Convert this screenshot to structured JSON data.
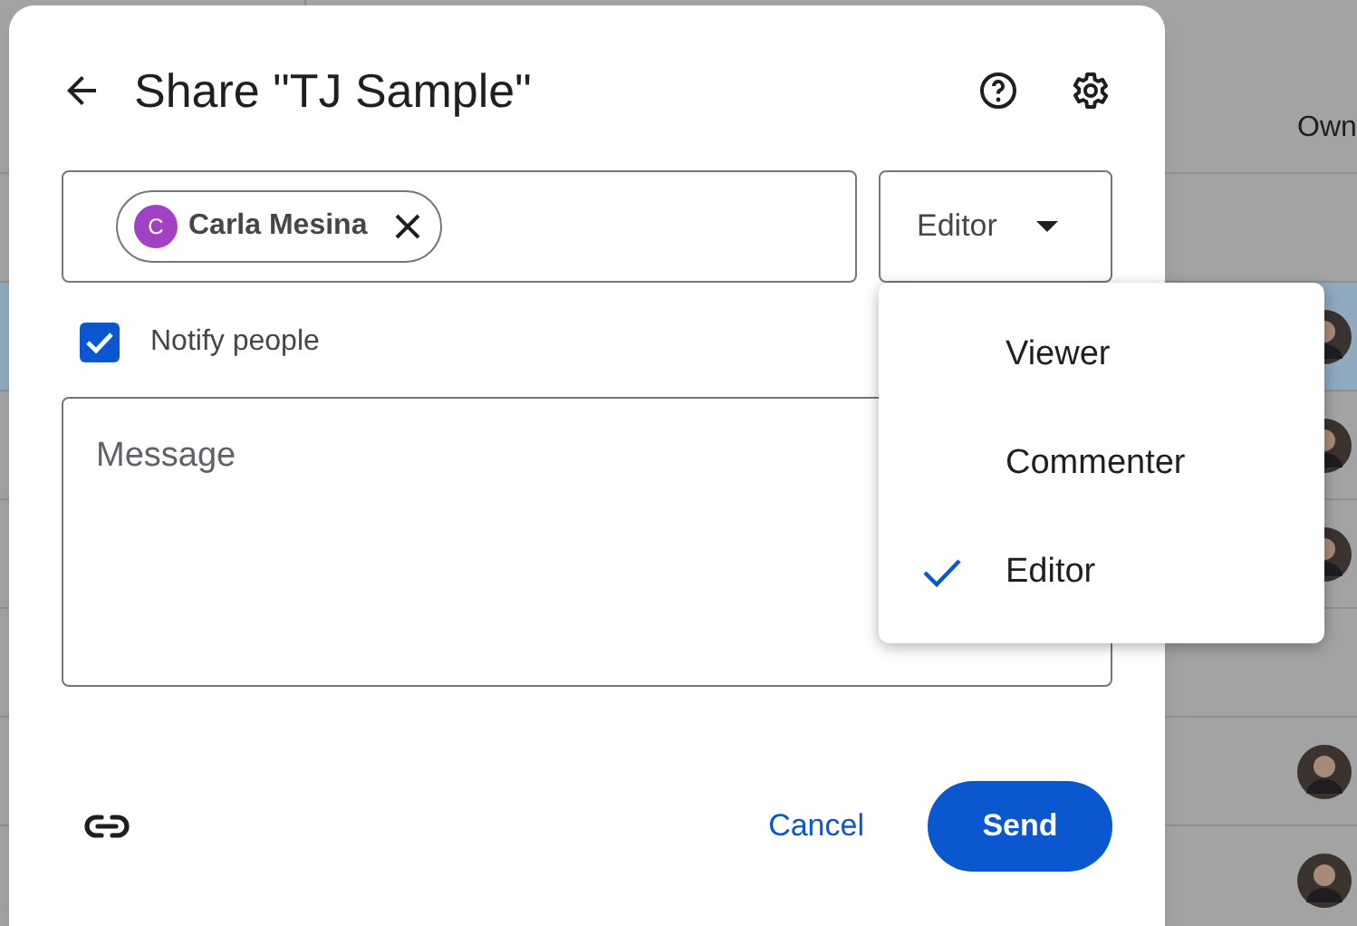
{
  "background": {
    "header_right": "Own",
    "rows": [
      {
        "selected": false,
        "avatar": false
      },
      {
        "selected": true,
        "avatar": true
      },
      {
        "selected": false,
        "avatar": true
      },
      {
        "selected": false,
        "avatar": true
      },
      {
        "selected": false,
        "avatar": false
      },
      {
        "selected": false,
        "avatar": true
      },
      {
        "selected": false,
        "avatar": true
      }
    ]
  },
  "dialog": {
    "title": "Share \"TJ Sample\"",
    "recipients": [
      {
        "initial": "C",
        "name": "Carla Mesina",
        "color": "#a142c4"
      }
    ],
    "role": "Editor",
    "notify": {
      "label": "Notify people",
      "checked": true
    },
    "message": {
      "placeholder": "Message"
    },
    "buttons": {
      "cancel": "Cancel",
      "send": "Send"
    }
  },
  "role_menu": [
    {
      "label": "Viewer",
      "selected": false
    },
    {
      "label": "Commenter",
      "selected": false
    },
    {
      "label": "Editor",
      "selected": true
    }
  ]
}
